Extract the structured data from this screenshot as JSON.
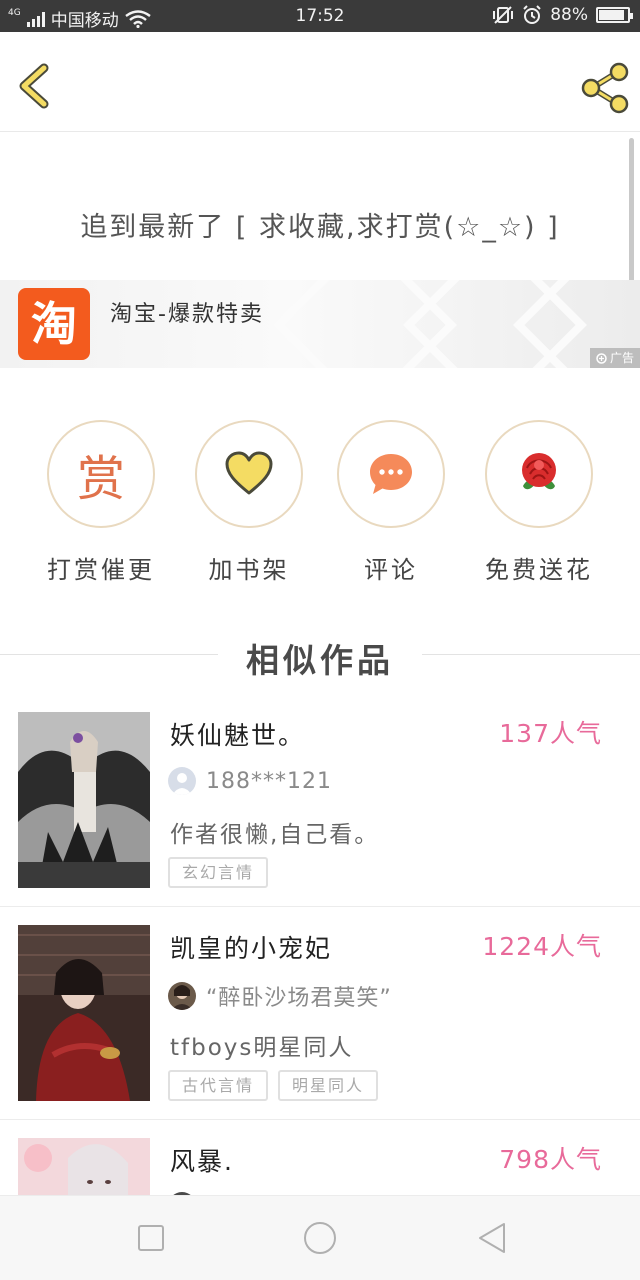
{
  "status_bar": {
    "network": "4G",
    "carrier": "中国移动",
    "time": "17:52",
    "battery": "88%",
    "battery_level": 0.88,
    "icons": [
      "signal-icon",
      "wifi-icon",
      "vibrate-off-icon",
      "alarm-icon",
      "battery-icon"
    ]
  },
  "header": {
    "back_icon": "chevron-left-icon",
    "share_icon": "share-icon"
  },
  "chapter": {
    "end_text": "追到最新了 [ 求收藏,求打赏(☆_☆) ]"
  },
  "ad": {
    "logo_char": "淘",
    "title": "淘宝-爆款特卖",
    "tag": "广告"
  },
  "actions": [
    {
      "label": "打赏催更",
      "icon": "reward-icon",
      "glyph": "赏"
    },
    {
      "label": "加书架",
      "icon": "heart-icon"
    },
    {
      "label": "评论",
      "icon": "comment-icon"
    },
    {
      "label": "免费送花",
      "icon": "rose-icon"
    }
  ],
  "similar": {
    "title": "相似作品",
    "items": [
      {
        "title": "妖仙魅世。",
        "popularity": "137人气",
        "author": "188***121",
        "description": "作者很懒,自己看。",
        "tags": [
          "玄幻言情"
        ]
      },
      {
        "title": "凯皇的小宠妃",
        "popularity": "1224人气",
        "author": "“醉卧沙场君莫笑”",
        "description": "tfboys明星同人",
        "tags": [
          "古代言情",
          "明星同人"
        ]
      },
      {
        "title": "风暴.",
        "popularity": "798人气",
        "author": "",
        "description": "",
        "tags": []
      }
    ]
  },
  "nav_bar": {
    "icons": [
      "recents-square-icon",
      "home-circle-icon",
      "back-triangle-icon"
    ]
  },
  "colors": {
    "accent_yellow": "#f4dc63",
    "popularity_pink": "#e86a9a",
    "taobao_orange": "#f35b1e",
    "circle_border": "#e9d9bf"
  }
}
